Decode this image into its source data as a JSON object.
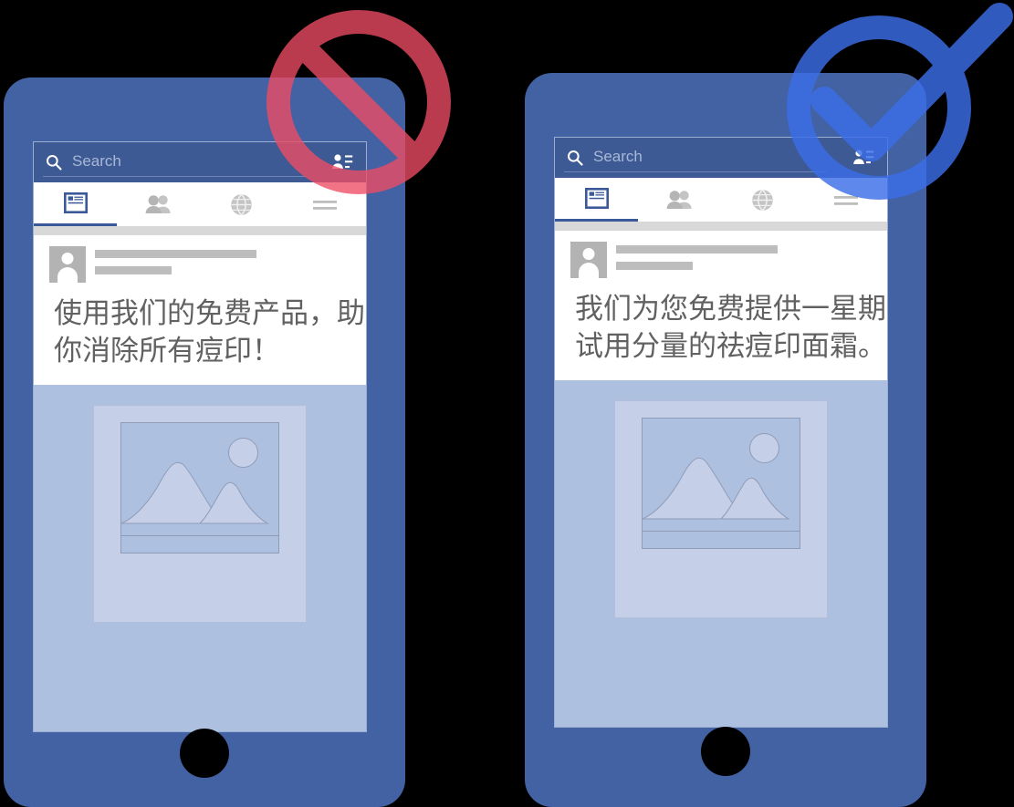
{
  "background_color": "#000000",
  "panels": [
    {
      "id": "bad-example",
      "badge": "prohibition-sign",
      "badge_color": "#ef4c64",
      "phone_color": "#4362a3",
      "app": {
        "search": {
          "placeholder": "Search",
          "icon": "search-icon"
        },
        "header_icons": [
          "messenger-icon",
          "contacts-icon"
        ],
        "nav_tabs": [
          {
            "name": "newsfeed",
            "icon": "newsfeed-icon",
            "active": true
          },
          {
            "name": "friends",
            "icon": "friends-icon",
            "active": false
          },
          {
            "name": "globe",
            "icon": "globe-icon",
            "active": false
          },
          {
            "name": "menu",
            "icon": "hamburger-menu-icon",
            "active": false
          }
        ],
        "post": {
          "author_placeholder": "avatar-placeholder",
          "text": "使用我们的免费产品，助你消除所有痘印！",
          "image_placeholder": "image-placeholder-icon"
        }
      }
    },
    {
      "id": "good-example",
      "badge": "checkmark-sign",
      "badge_color": "#3b6ee8",
      "phone_color": "#4362a3",
      "app": {
        "search": {
          "placeholder": "Search",
          "icon": "search-icon"
        },
        "header_icons": [
          "messenger-icon",
          "contacts-icon"
        ],
        "nav_tabs": [
          {
            "name": "newsfeed",
            "icon": "newsfeed-icon",
            "active": true
          },
          {
            "name": "friends",
            "icon": "friends-icon",
            "active": false
          },
          {
            "name": "globe",
            "icon": "globe-icon",
            "active": false
          },
          {
            "name": "menu",
            "icon": "hamburger-menu-icon",
            "active": false
          }
        ],
        "post": {
          "author_placeholder": "avatar-placeholder",
          "text": "我们为您免费提供一星期试用分量的祛痘印面霜。",
          "image_placeholder": "image-placeholder-icon"
        }
      }
    }
  ],
  "colors": {
    "facebook_blue": "#3b5998",
    "search_bar": "#3d5a94",
    "screen_bg": "#aec0e0",
    "post_bg": "#ffffff",
    "placeholder_gray": "#bdbdbd",
    "text_gray": "#616161",
    "prohibition_red": "#ef4c64",
    "check_blue": "#3b6ee8"
  }
}
